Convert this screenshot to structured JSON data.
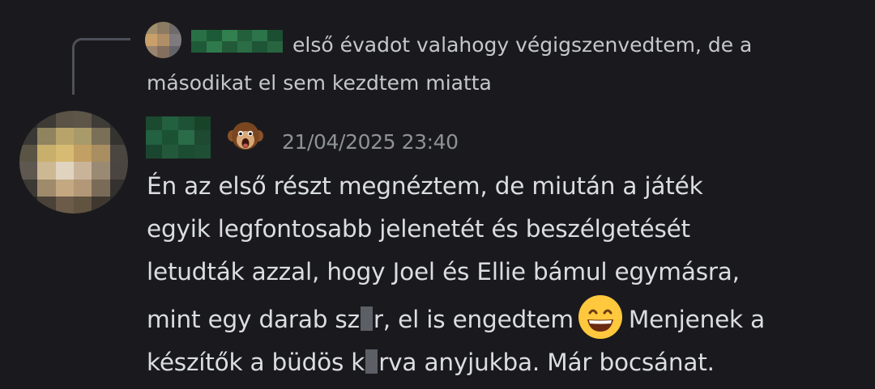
{
  "reply": {
    "text": "első évadot valahogy végigszenvedtem, de a másodikat el sem kezdtem miatta"
  },
  "message": {
    "timestamp": "21/04/2025 23:40",
    "lines": [
      "Én az első részt megnéztem, de miután a játék",
      "egyik legfontosabb jelenetét és beszélgetését",
      "letudták azzal, hogy Joel és Ellie bámul egymásra,"
    ],
    "line4_before": "mint egy darab sz",
    "line4_mid": "r, el is engedtem",
    "line4_after": "Menjenek a",
    "line5_before": "készítők a büdös k",
    "line5_after": "rva anyjukba. Már bocsánat."
  },
  "icons": {
    "author_badge": "monkey-face-icon",
    "inline_emoji": "grinning-smiling-eyes-emoji"
  },
  "colors": {
    "background": "#1a1a1e",
    "text": "#dbdee1",
    "timestamp": "#8e9297",
    "reply_text": "#c4c7cc",
    "username_blurred": "#1f5a38"
  }
}
